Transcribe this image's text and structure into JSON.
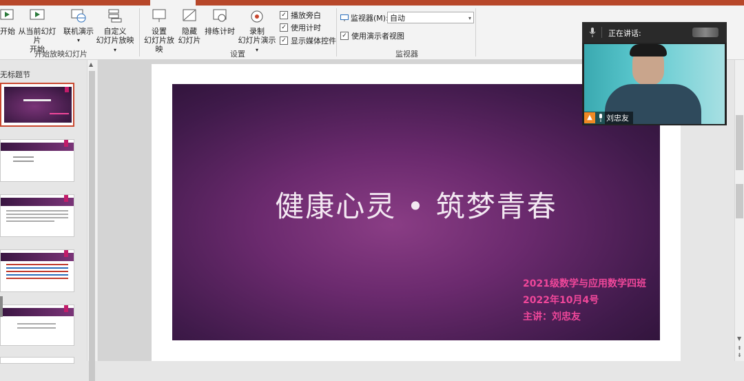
{
  "ribbon": {
    "groups": {
      "start": "开始放映幻灯片",
      "setup": "设置",
      "monitor": "监视器"
    },
    "buttons": {
      "from_start": "开始",
      "from_current_1": "从当前幻灯片",
      "from_current_2": "开始",
      "online": "联机演示",
      "custom_1": "自定义",
      "custom_2": "幻灯片放映",
      "setup_1": "设置",
      "setup_2": "幻灯片放映",
      "hide_1": "隐藏",
      "hide_2": "幻灯片",
      "rehearse": "排练计时",
      "record_1": "录制",
      "record_2": "幻灯片演示"
    },
    "checkboxes": {
      "narration": "播放旁白",
      "timings": "使用计时",
      "media": "显示媒体控件",
      "presenter": "使用演示者视图"
    },
    "monitor_label": "监视器(M):",
    "monitor_value": "自动"
  },
  "thumbpane": {
    "section": "无标题节"
  },
  "slide": {
    "title": "健康心灵 • 筑梦青春",
    "line1": "2021级数学与应用数学四班",
    "line2": "2022年10月4号",
    "line3": "主讲：刘忠友"
  },
  "video": {
    "speaking_label": "正在讲话:",
    "name": "刘忠友"
  }
}
